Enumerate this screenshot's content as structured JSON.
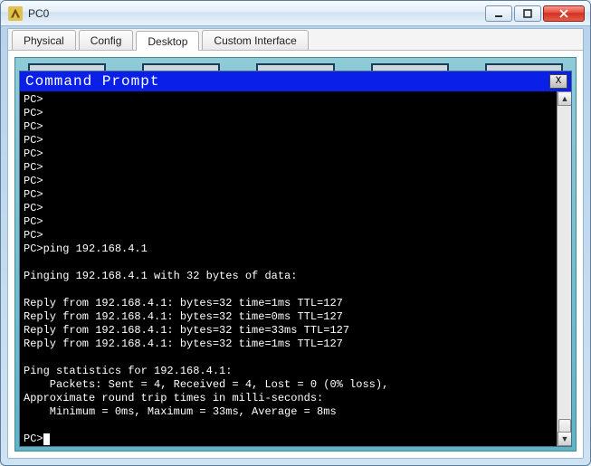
{
  "window": {
    "title": "PC0"
  },
  "tabs": {
    "physical": "Physical",
    "config": "Config",
    "desktop": "Desktop",
    "custom": "Custom Interface"
  },
  "terminal": {
    "title": "Command Prompt",
    "close_label": "X",
    "lines": [
      "PC>",
      "PC>",
      "PC>",
      "PC>",
      "PC>",
      "PC>",
      "PC>",
      "PC>",
      "PC>",
      "PC>",
      "PC>",
      "PC>ping 192.168.4.1",
      "",
      "Pinging 192.168.4.1 with 32 bytes of data:",
      "",
      "Reply from 192.168.4.1: bytes=32 time=1ms TTL=127",
      "Reply from 192.168.4.1: bytes=32 time=0ms TTL=127",
      "Reply from 192.168.4.1: bytes=32 time=33ms TTL=127",
      "Reply from 192.168.4.1: bytes=32 time=1ms TTL=127",
      "",
      "Ping statistics for 192.168.4.1:",
      "    Packets: Sent = 4, Received = 4, Lost = 0 (0% loss),",
      "Approximate round trip times in milli-seconds:",
      "    Minimum = 0ms, Maximum = 33ms, Average = 8ms",
      "",
      "PC>"
    ]
  }
}
